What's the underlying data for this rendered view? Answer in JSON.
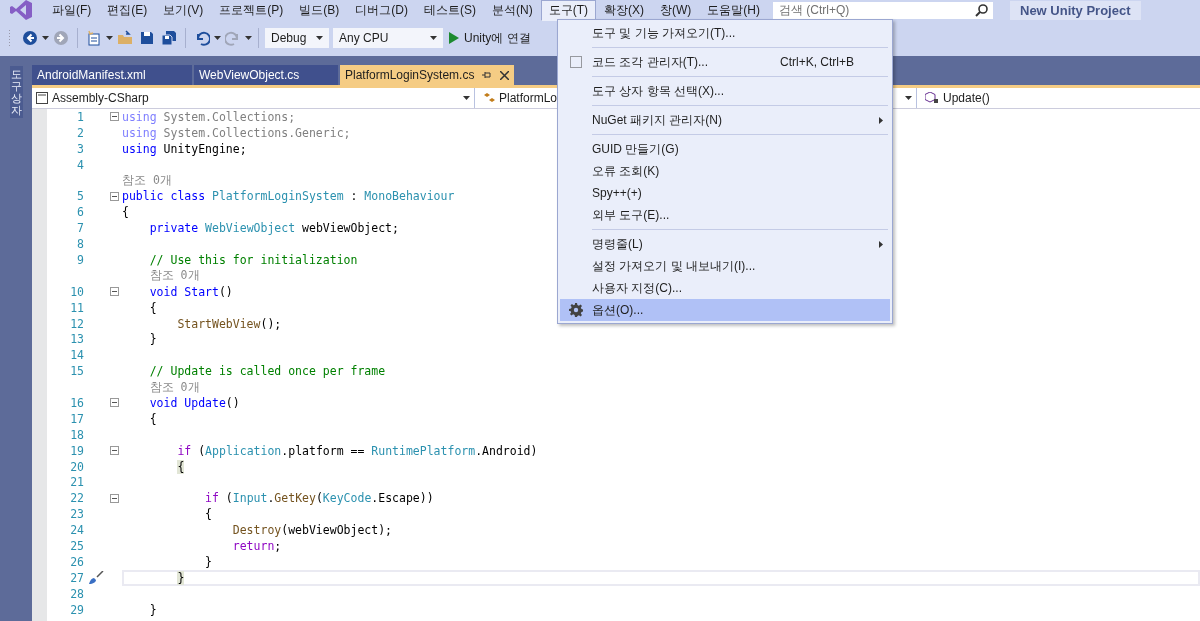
{
  "menu_bar": [
    {
      "label": "파일(F)",
      "selected": false
    },
    {
      "label": "편집(E)",
      "selected": false
    },
    {
      "label": "보기(V)",
      "selected": false
    },
    {
      "label": "프로젝트(P)",
      "selected": false
    },
    {
      "label": "빌드(B)",
      "selected": false
    },
    {
      "label": "디버그(D)",
      "selected": false
    },
    {
      "label": "테스트(S)",
      "selected": false
    },
    {
      "label": "분석(N)",
      "selected": false
    },
    {
      "label": "도구(T)",
      "selected": true
    },
    {
      "label": "확장(X)",
      "selected": false
    },
    {
      "label": "창(W)",
      "selected": false
    },
    {
      "label": "도움말(H)",
      "selected": false
    }
  ],
  "search": {
    "placeholder": "검색 (Ctrl+Q)"
  },
  "project_button": "New Unity Project",
  "toolbar": {
    "buttons": [
      {
        "kind": "back",
        "disabled": false
      },
      {
        "kind": "forward",
        "disabled": true
      },
      {
        "kind": "new",
        "disabled": false
      },
      {
        "kind": "open",
        "disabled": false
      },
      {
        "kind": "save",
        "disabled": false
      },
      {
        "kind": "saveall",
        "disabled": false
      },
      {
        "kind": "undo",
        "disabled": false
      },
      {
        "kind": "redo",
        "disabled": true
      }
    ],
    "configuration": "Debug",
    "platform": "Any CPU",
    "run_label": "Unity에 연결"
  },
  "side_panel": {
    "tab": "도구 상자"
  },
  "tabs": [
    {
      "label": "AndroidManifest.xml",
      "selected": false
    },
    {
      "label": "WebViewObject.cs",
      "selected": false
    },
    {
      "label": "PlatformLoginSystem.cs",
      "selected": true
    }
  ],
  "nav_bar": {
    "project": "Assembly-CSharp",
    "type": "PlatformLo",
    "member": "Update()"
  },
  "code": {
    "rows": [
      {
        "number": "1",
        "fold": true,
        "tokens": [
          {
            "kind": "kw_faded",
            "text": "using"
          },
          {
            "kind": "faded",
            "text": " System.Collections;"
          }
        ]
      },
      {
        "number": "2",
        "tokens": [
          {
            "kind": "kw_faded",
            "text": "using"
          },
          {
            "kind": "faded",
            "text": " System.Collections.Generic;"
          }
        ]
      },
      {
        "number": "3",
        "tokens": [
          {
            "kind": "kw",
            "text": "using"
          },
          {
            "kind": "plain",
            "text": " UnityEngine;"
          }
        ]
      },
      {
        "number": "4"
      },
      {
        "lens": "참조 0개"
      },
      {
        "number": "5",
        "fold": true,
        "tokens": [
          {
            "kind": "kw",
            "text": "public class "
          },
          {
            "kind": "type",
            "text": "PlatformLoginSystem"
          },
          {
            "kind": "plain",
            "text": " : "
          },
          {
            "kind": "type",
            "text": "MonoBehaviour"
          }
        ]
      },
      {
        "number": "6",
        "tokens": [
          {
            "kind": "plain",
            "text": "{"
          }
        ]
      },
      {
        "number": "7",
        "tokens": [
          {
            "kind": "kw",
            "text": "    private "
          },
          {
            "kind": "type",
            "text": "WebViewObject"
          },
          {
            "kind": "plain",
            "text": " webViewObject;"
          }
        ]
      },
      {
        "number": "8"
      },
      {
        "number": "9",
        "tokens": [
          {
            "kind": "comment",
            "text": "    // Use this for initialization"
          }
        ]
      },
      {
        "lens": "    참조 0개"
      },
      {
        "number": "10",
        "fold": true,
        "tokens": [
          {
            "kind": "kw",
            "text": "    void Start"
          },
          {
            "kind": "plain",
            "text": "()"
          }
        ]
      },
      {
        "number": "11",
        "tokens": [
          {
            "kind": "plain",
            "text": "    {"
          }
        ]
      },
      {
        "number": "12",
        "tokens": [
          {
            "kind": "method",
            "text": "        StartWebView"
          },
          {
            "kind": "plain",
            "text": "();"
          }
        ]
      },
      {
        "number": "13",
        "tokens": [
          {
            "kind": "plain",
            "text": "    }"
          }
        ]
      },
      {
        "number": "14"
      },
      {
        "number": "15",
        "tokens": [
          {
            "kind": "comment",
            "text": "    // Update is called once per frame"
          }
        ]
      },
      {
        "lens": "    참조 0개"
      },
      {
        "number": "16",
        "fold": true,
        "tokens": [
          {
            "kind": "kw",
            "text": "    void Update"
          },
          {
            "kind": "plain",
            "text": "()"
          }
        ]
      },
      {
        "number": "17",
        "tokens": [
          {
            "kind": "plain",
            "text": "    {"
          }
        ]
      },
      {
        "number": "18"
      },
      {
        "number": "19",
        "fold": true,
        "tokens": [
          {
            "kind": "control",
            "text": "        if"
          },
          {
            "kind": "plain",
            "text": " ("
          },
          {
            "kind": "type",
            "text": "Application"
          },
          {
            "kind": "plain",
            "text": ".platform == "
          },
          {
            "kind": "type",
            "text": "RuntimePlatform"
          },
          {
            "kind": "plain",
            "text": ".Android)"
          }
        ]
      },
      {
        "number": "20",
        "tokens": [
          {
            "kind": "brace",
            "text": "        {"
          }
        ]
      },
      {
        "number": "21"
      },
      {
        "number": "22",
        "fold": true,
        "tokens": [
          {
            "kind": "control",
            "text": "            if"
          },
          {
            "kind": "plain",
            "text": " ("
          },
          {
            "kind": "type",
            "text": "Input"
          },
          {
            "kind": "plain",
            "text": "."
          },
          {
            "kind": "method",
            "text": "GetKey"
          },
          {
            "kind": "plain",
            "text": "("
          },
          {
            "kind": "type",
            "text": "KeyCode"
          },
          {
            "kind": "plain",
            "text": ".Escape))"
          }
        ]
      },
      {
        "number": "23",
        "tokens": [
          {
            "kind": "plain",
            "text": "            {"
          }
        ]
      },
      {
        "number": "24",
        "tokens": [
          {
            "kind": "method",
            "text": "                Destroy"
          },
          {
            "kind": "plain",
            "text": "(webViewObject);"
          }
        ]
      },
      {
        "number": "25",
        "tokens": [
          {
            "kind": "control",
            "text": "                return"
          },
          {
            "kind": "plain",
            "text": ";"
          }
        ]
      },
      {
        "number": "26",
        "tokens": [
          {
            "kind": "plain",
            "text": "            }"
          }
        ]
      },
      {
        "number": "27",
        "current": true,
        "quick_action": true,
        "tokens": [
          {
            "kind": "brace",
            "text": "        }"
          }
        ]
      },
      {
        "number": "28"
      },
      {
        "number": "29",
        "tokens": [
          {
            "kind": "plain",
            "text": "    }"
          }
        ]
      }
    ]
  },
  "tools_menu": {
    "groups": [
      [
        {
          "label": "도구 및 기능 가져오기(T)...",
          "kind": "plain",
          "selected": false
        }
      ],
      [
        {
          "label": "코드 조각 관리자(T)...",
          "kind": "snippet",
          "shortcut": "Ctrl+K, Ctrl+B",
          "selected": false
        }
      ],
      [
        {
          "label": "도구 상자 항목 선택(X)...",
          "kind": "plain",
          "selected": false
        }
      ],
      [
        {
          "label": "NuGet 패키지 관리자(N)",
          "kind": "plain",
          "submenu": true,
          "selected": false
        }
      ],
      [
        {
          "label": "GUID 만들기(G)",
          "kind": "plain",
          "selected": false
        },
        {
          "label": "오류 조회(K)",
          "kind": "plain",
          "selected": false
        },
        {
          "label": "Spy++(+)",
          "kind": "plain",
          "selected": false
        },
        {
          "label": "외부 도구(E)...",
          "kind": "plain",
          "selected": false
        }
      ],
      [
        {
          "label": "명령줄(L)",
          "kind": "plain",
          "submenu": true,
          "selected": false
        },
        {
          "label": "설정 가져오기 및 내보내기(I)...",
          "kind": "plain",
          "selected": false
        },
        {
          "label": "사용자 지정(C)...",
          "kind": "plain",
          "selected": false
        },
        {
          "label": "옵션(O)...",
          "kind": "gear",
          "selected": true
        }
      ]
    ]
  }
}
